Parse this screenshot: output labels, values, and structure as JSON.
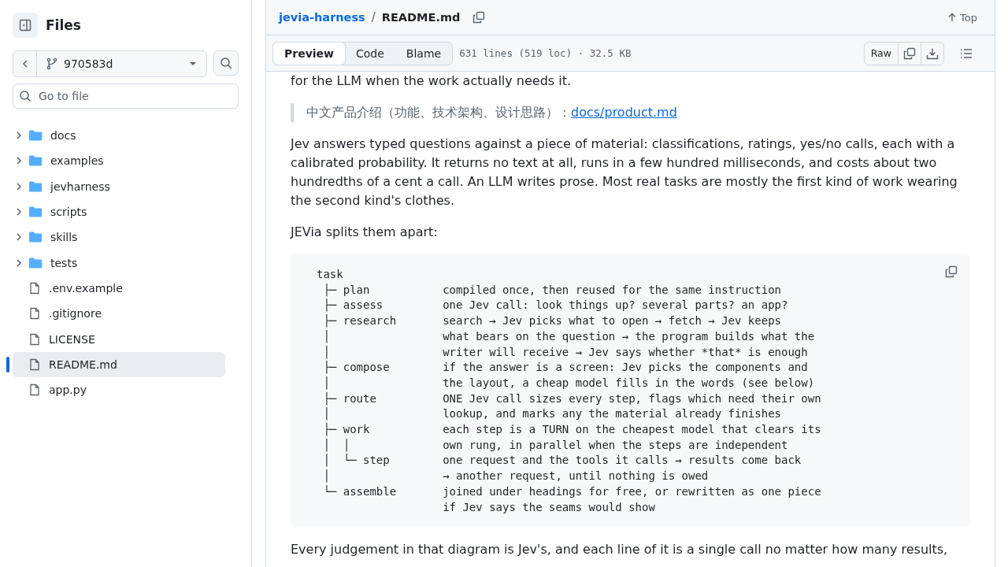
{
  "sidebar": {
    "title": "Files",
    "branch": "970583d",
    "search_placeholder": "Go to file",
    "tree": [
      {
        "name": "docs",
        "kind": "folder",
        "expanded": false,
        "selected": false
      },
      {
        "name": "examples",
        "kind": "folder",
        "expanded": false,
        "selected": false
      },
      {
        "name": "jevharness",
        "kind": "folder",
        "expanded": false,
        "selected": false
      },
      {
        "name": "scripts",
        "kind": "folder",
        "expanded": false,
        "selected": false
      },
      {
        "name": "skills",
        "kind": "folder",
        "expanded": false,
        "selected": false
      },
      {
        "name": "tests",
        "kind": "folder",
        "expanded": false,
        "selected": false
      },
      {
        "name": ".env.example",
        "kind": "file",
        "selected": false
      },
      {
        "name": ".gitignore",
        "kind": "file",
        "selected": false
      },
      {
        "name": "LICENSE",
        "kind": "file",
        "selected": false
      },
      {
        "name": "README.md",
        "kind": "file",
        "selected": true
      },
      {
        "name": "app.py",
        "kind": "file",
        "selected": false
      }
    ]
  },
  "header": {
    "repo": "jevia-harness",
    "separator": "/",
    "file": "README.md",
    "top": "Top"
  },
  "toolbar": {
    "tabs": [
      {
        "label": "Preview",
        "selected": true
      },
      {
        "label": "Code",
        "selected": false
      },
      {
        "label": "Blame",
        "selected": false
      }
    ],
    "info": "631 lines (519 loc) · 32.5 KB",
    "raw": "Raw"
  },
  "content": [
    {
      "kind": "paragraph",
      "text": "for the LLM when the work actually needs it."
    },
    {
      "kind": "quote",
      "text": "中文产品介绍（功能、技术架构、设计思路）：",
      "link": "docs/product.md"
    },
    {
      "kind": "paragraph",
      "text": "Jev answers typed questions against a piece of material: classifications, ratings, yes/no calls, each with a calibrated probability. It returns no text at all, runs in a few hundred milliseconds, and costs about two hundredths of a cent a call. An LLM writes prose. Most real tasks are mostly the first kind of work wearing the second kind's clothes."
    },
    {
      "kind": "paragraph",
      "text": "JEVia splits them apart:"
    },
    {
      "kind": "code",
      "lines": [
        "task",
        " ├─ plan           compiled once, then reused for the same instruction",
        " ├─ assess         one Jev call: look things up? several parts? an app?",
        " ├─ research       search → Jev picks what to open → fetch → Jev keeps",
        " │                 what bears on the question → the program builds what the",
        " │                 writer will receive → Jev says whether *that* is enough",
        " ├─ compose        if the answer is a screen: Jev picks the components and",
        " │                 the layout, a cheap model fills in the words (see below)",
        " ├─ route          ONE Jev call sizes every step, flags which need their own",
        " │                 lookup, and marks any the material already finishes",
        " ├─ work           each step is a TURN on the cheapest model that clears its",
        " │  │              own rung, in parallel when the steps are independent",
        " │  └─ step        one request and the tools it calls → results come back",
        " │                 → another request, until nothing is owed",
        " └─ assemble       joined under headings for free, or rewritten as one piece",
        "                   if Jev says the seams would show"
      ]
    },
    {
      "kind": "paragraph",
      "text": "Every judgement in that diagram is Jev's, and each line of it is a single call no matter how many results,"
    }
  ]
}
